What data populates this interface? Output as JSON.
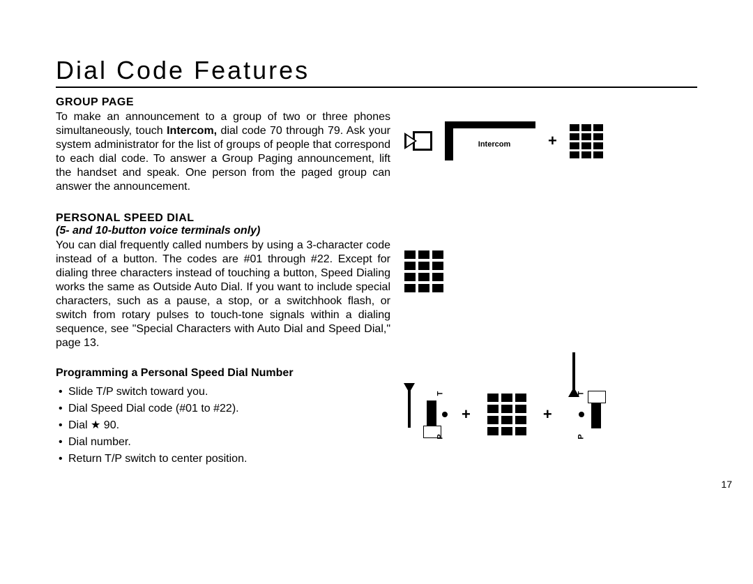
{
  "title": "Dial Code Features",
  "page_number": "17",
  "group_page": {
    "heading": "GROUP  PAGE",
    "body_before_bold": "To make an announcement to a group of two or three phones simultaneously, touch ",
    "intercom_word": "Intercom,",
    "body_after_bold": " dial code 70 through 79. Ask your system administrator for the list of groups of people that correspond to each dial code. To answer a Group Paging announcement, lift the handset and speak. One person from the paged group can answer the announcement."
  },
  "speed_dial": {
    "heading": "PERSONAL SPEED DIAL",
    "subheading": "(5- and 10-button voice terminals only)",
    "body": "You can dial frequently called numbers by using a 3-character code instead of a button. The codes are #01 through #22. Except for dialing three characters instead of touching a button, Speed Dialing works the same as Outside Auto Dial. If you want to include special characters, such as a pause, a stop, or a switchhook flash, or switch from rotary pulses to touch-tone signals within a dialing sequence, see \"Special Characters with Auto Dial and Speed Dial,\" page 13."
  },
  "programming": {
    "heading": "Programming a Personal Speed Dial Number",
    "steps": [
      "Slide T/P switch toward you.",
      "Dial Speed Dial code (#01 to #22).",
      "Dial  ★ 90.",
      "Dial number.",
      "Return T/P switch to center position."
    ]
  },
  "figure_labels": {
    "intercom_button": "Intercom",
    "plus": "+",
    "switch_T": "T",
    "switch_P": "P"
  }
}
